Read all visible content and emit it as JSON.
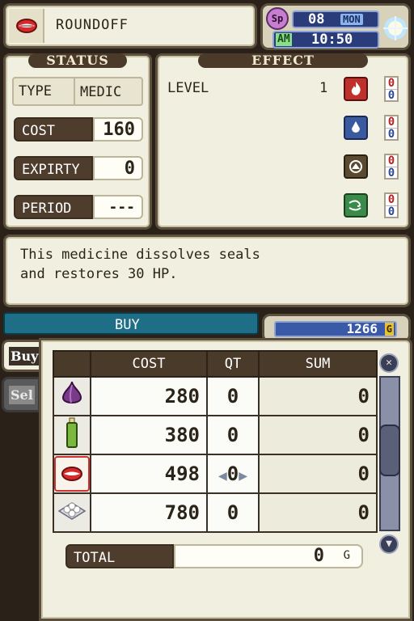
{
  "selected_item": {
    "name": "ROUNDOFF",
    "icon": "lips-icon"
  },
  "clock": {
    "sp_badge": "Sp",
    "day": "08",
    "weekday": "MON",
    "ampm": "AM",
    "time": "10:50",
    "weather_icon": "sun-icon"
  },
  "status": {
    "header": "STATUS",
    "type_label": "TYPE",
    "type_value": "MEDIC",
    "cost_label": "COST",
    "cost_value": "160",
    "expiry_label": "EXPIRTY",
    "expiry_value": "0",
    "period_label": "PERIOD",
    "period_value": "---"
  },
  "effect": {
    "header": "EFFECT",
    "level_label": "LEVEL",
    "level_value": "1",
    "elements": [
      {
        "icon": "fire-element-icon",
        "color": "#c0302a",
        "top": "0",
        "bottom": "0"
      },
      {
        "icon": "water-element-icon",
        "color": "#3a5aa0",
        "top": "0",
        "bottom": "0"
      },
      {
        "icon": "earth-element-icon",
        "color": "#5a4a30",
        "top": "0",
        "bottom": "0"
      },
      {
        "icon": "wind-element-icon",
        "color": "#3a8a4a",
        "top": "0",
        "bottom": "0"
      }
    ]
  },
  "description": {
    "line1": "This medicine dissolves seals",
    "line2": "and restores 30 HP."
  },
  "shop": {
    "mode_label": "BUY",
    "gold": "1266",
    "gold_unit": "G",
    "tabs": [
      {
        "label": "Buy"
      },
      {
        "label": "Sel"
      }
    ],
    "columns": [
      "COST",
      "QT",
      "SUM"
    ],
    "rows": [
      {
        "icon": "onion-icon",
        "cost": "280",
        "qt": "0",
        "sum": "0"
      },
      {
        "icon": "green-bottle-icon",
        "cost": "380",
        "qt": "0",
        "sum": "0"
      },
      {
        "icon": "lips-icon",
        "cost": "498",
        "qt": "0",
        "sum": "0",
        "selected": true
      },
      {
        "icon": "white-pills-icon",
        "cost": "780",
        "qt": "0",
        "sum": "0"
      }
    ],
    "total_label": "TOTAL",
    "total_value": "0",
    "total_unit": "G"
  },
  "colors": {
    "accent_red": "#d03030",
    "panel_bg": "#f1efdf",
    "dark_brown": "#4a3a2a",
    "buy_bar": "#1f6e88",
    "gold_bar": "#3a5aa8"
  }
}
